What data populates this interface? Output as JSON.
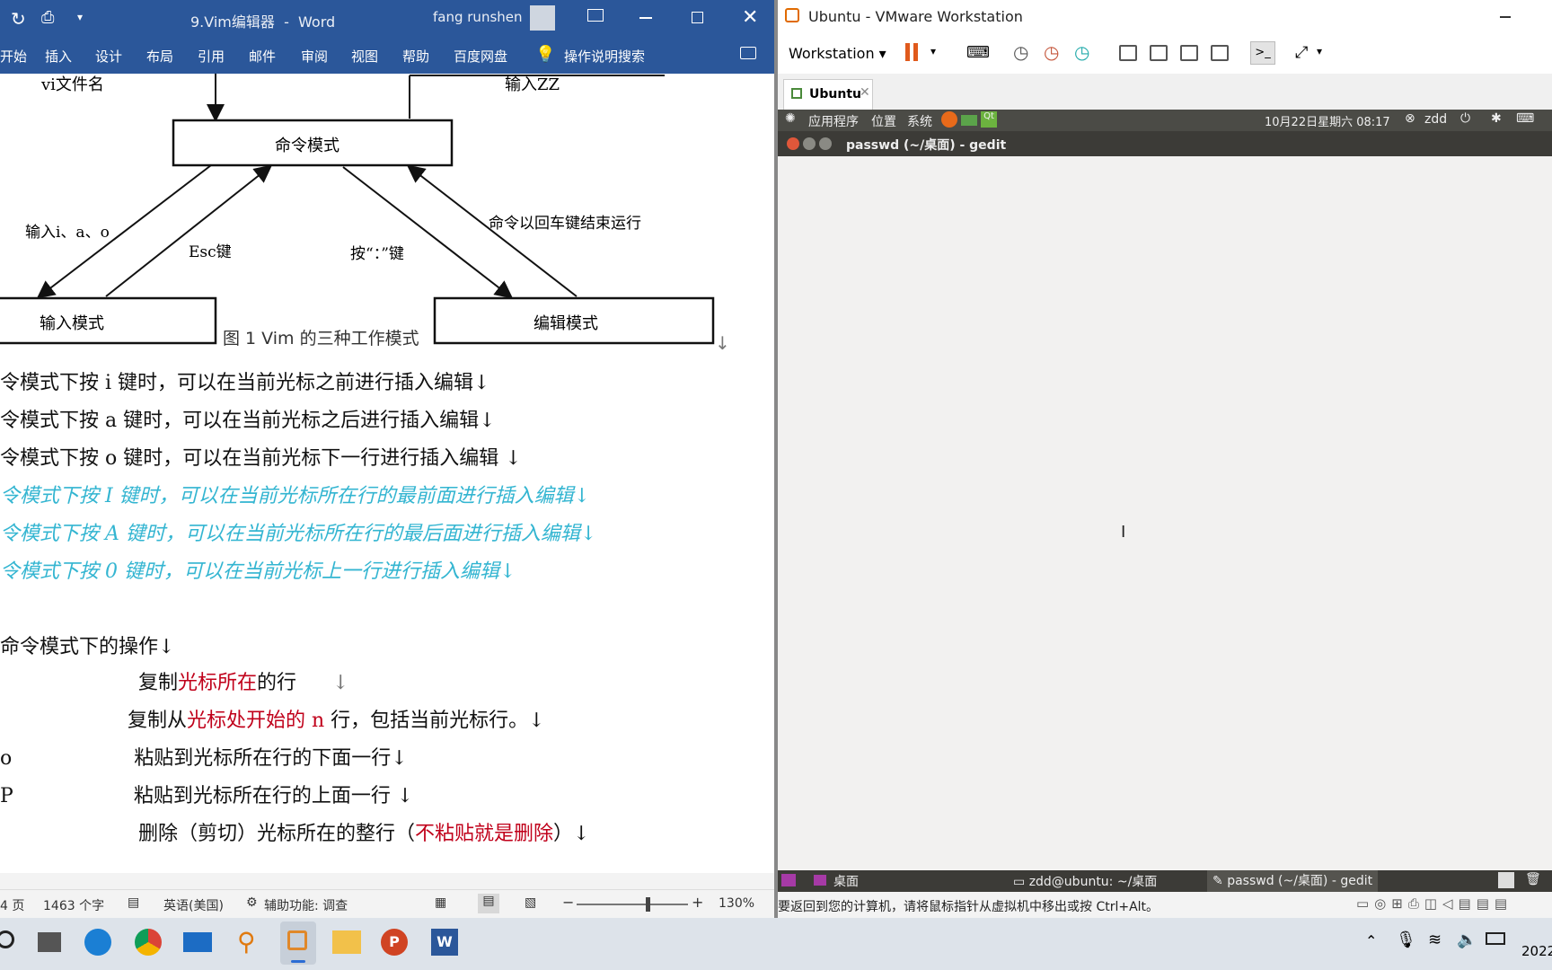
{
  "word": {
    "doc_title": "9.Vim编辑器",
    "app": "Word",
    "user": "fang runshen",
    "ribbon_tabs": [
      "开始",
      "插入",
      "设计",
      "布局",
      "引用",
      "邮件",
      "审阅",
      "视图",
      "帮助",
      "百度网盘"
    ],
    "tell_me": "操作说明搜索",
    "diagram": {
      "top_left_label": "vi文件名",
      "top_right_label": "输入ZZ",
      "cmd_mode": "命令模式",
      "input_mode": "输入模式",
      "edit_mode": "编辑模式",
      "lbl_input": "输入i、a、o",
      "lbl_esc": "Esc键",
      "lbl_colon": "按“：”键",
      "lbl_enter": "命令以回车键结束运行"
    },
    "caption": "图 1 Vim 的三种工作模式",
    "lines": {
      "l1": "令模式下按 i 键时，可以在当前光标之前进行插入编辑↓",
      "l2": "令模式下按 a 键时，可以在当前光标之后进行插入编辑↓",
      "l3": "令模式下按 o 键时，可以在当前光标下一行进行插入编辑 ↓",
      "l4": "令模式下按 I 键时，可以在当前光标所在行的最前面进行插入编辑↓",
      "l5": "令模式下按 A 键时，可以在当前光标所在行的最后面进行插入编辑↓",
      "l6": "令模式下按 0 键时，可以在当前光标上一行进行插入编辑↓",
      "l7": "命令模式下的操作↓",
      "l8a": "复制",
      "l8b": "光标所在",
      "l8c": "的行",
      "l8d": "↓",
      "l9a": "复制从",
      "l9b": "光标处开始的 n",
      "l9c": " 行，包括当前光标行。↓",
      "l10p": "o",
      "l10": "粘贴到光标所在行的下面一行↓",
      "l11p": "P",
      "l11": "粘贴到光标所在行的上面一行 ↓",
      "l12a": "删除（剪切）光标所在的整行（",
      "l12b": "不粘贴就是删除",
      "l12c": "）↓"
    },
    "status": {
      "page": "4 页",
      "words": "1463 个字",
      "lang": "英语(美国)",
      "access": "辅助功能: 调查",
      "zoom": "130%",
      "zoom_level": 0.62
    }
  },
  "vm": {
    "title": "Ubuntu - VMware Workstation",
    "menu": "Workstation",
    "tab": "Ubuntu",
    "panel": {
      "apps": "应用程序",
      "places": "位置",
      "system": "系统",
      "datetime": "10月22日星期六 08:17",
      "user": "zdd"
    },
    "gedit_title": "passwd (~/桌面) - gedit",
    "bottom": {
      "desktop": "桌面",
      "terminal": "zdd@ubuntu: ~/桌面",
      "gedit": "passwd (~/桌面) - gedit"
    },
    "status_msg": "要返回到您的计算机，请将鼠标指针从虚拟机中移出或按 Ctrl+Alt。"
  },
  "taskbar": {
    "year": "2022"
  },
  "colors": {
    "word_blue": "#2b579a",
    "cyan_text": "#33b5d1",
    "red_text": "#c0001a"
  }
}
